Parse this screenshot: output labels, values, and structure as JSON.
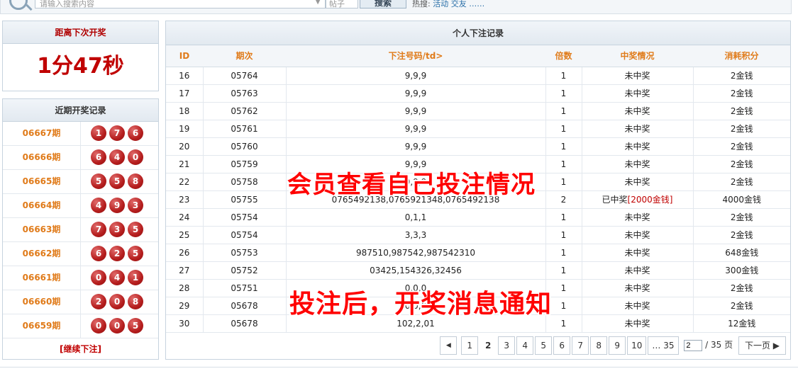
{
  "topbar": {
    "search_placeholder": "请输入搜索内容",
    "select_value": "帖子",
    "search_button": "搜索",
    "hot_label": "热搜:",
    "hot_links": "活动 交友 ……"
  },
  "countdown": {
    "title": "距离下次开奖",
    "time": "1分47秒"
  },
  "recent": {
    "title": "近期开奖记录",
    "rows": [
      {
        "period": "06667期",
        "balls": [
          "1",
          "7",
          "6"
        ]
      },
      {
        "period": "06666期",
        "balls": [
          "6",
          "4",
          "0"
        ]
      },
      {
        "period": "06665期",
        "balls": [
          "5",
          "5",
          "8"
        ]
      },
      {
        "period": "06664期",
        "balls": [
          "4",
          "9",
          "3"
        ]
      },
      {
        "period": "06663期",
        "balls": [
          "7",
          "3",
          "5"
        ]
      },
      {
        "period": "06662期",
        "balls": [
          "6",
          "2",
          "5"
        ]
      },
      {
        "period": "06661期",
        "balls": [
          "0",
          "4",
          "1"
        ]
      },
      {
        "period": "06660期",
        "balls": [
          "2",
          "0",
          "8"
        ]
      },
      {
        "period": "06659期",
        "balls": [
          "0",
          "0",
          "5"
        ]
      }
    ],
    "continue_label": "[继续下注]"
  },
  "records": {
    "title": "个人下注记录",
    "columns": [
      "ID",
      "期次",
      "下注号码/td>",
      "倍数",
      "中奖情况",
      "消耗积分"
    ],
    "rows": [
      {
        "id": "16",
        "period": "05764",
        "numbers": "9,9,9",
        "multiple": "1",
        "result": "未中奖",
        "prize": "",
        "cost": "2金钱"
      },
      {
        "id": "17",
        "period": "05763",
        "numbers": "9,9,9",
        "multiple": "1",
        "result": "未中奖",
        "prize": "",
        "cost": "2金钱"
      },
      {
        "id": "18",
        "period": "05762",
        "numbers": "9,9,9",
        "multiple": "1",
        "result": "未中奖",
        "prize": "",
        "cost": "2金钱"
      },
      {
        "id": "19",
        "period": "05761",
        "numbers": "9,9,9",
        "multiple": "1",
        "result": "未中奖",
        "prize": "",
        "cost": "2金钱"
      },
      {
        "id": "20",
        "period": "05760",
        "numbers": "9,9,9",
        "multiple": "1",
        "result": "未中奖",
        "prize": "",
        "cost": "2金钱"
      },
      {
        "id": "21",
        "period": "05759",
        "numbers": "9,9,9",
        "multiple": "1",
        "result": "未中奖",
        "prize": "",
        "cost": "2金钱"
      },
      {
        "id": "22",
        "period": "05758",
        "numbers": "9,9,9",
        "multiple": "1",
        "result": "未中奖",
        "prize": "",
        "cost": "2金钱"
      },
      {
        "id": "23",
        "period": "05755",
        "numbers": "0765492138,0765921348,0765492138",
        "multiple": "2",
        "result": "已中奖",
        "prize": "[2000金钱]",
        "cost": "4000金钱"
      },
      {
        "id": "24",
        "period": "05754",
        "numbers": "0,1,1",
        "multiple": "1",
        "result": "未中奖",
        "prize": "",
        "cost": "2金钱"
      },
      {
        "id": "25",
        "period": "05754",
        "numbers": "3,3,3",
        "multiple": "1",
        "result": "未中奖",
        "prize": "",
        "cost": "2金钱"
      },
      {
        "id": "26",
        "period": "05753",
        "numbers": "987510,987542,987542310",
        "multiple": "1",
        "result": "未中奖",
        "prize": "",
        "cost": "648金钱"
      },
      {
        "id": "27",
        "period": "05752",
        "numbers": "03425,154326,32456",
        "multiple": "1",
        "result": "未中奖",
        "prize": "",
        "cost": "300金钱"
      },
      {
        "id": "28",
        "period": "05751",
        "numbers": "0,0,0",
        "multiple": "1",
        "result": "未中奖",
        "prize": "",
        "cost": "2金钱"
      },
      {
        "id": "29",
        "period": "05678",
        "numbers": "0,0,0",
        "multiple": "1",
        "result": "未中奖",
        "prize": "",
        "cost": "2金钱"
      },
      {
        "id": "30",
        "period": "05678",
        "numbers": "102,2,01",
        "multiple": "1",
        "result": "未中奖",
        "prize": "",
        "cost": "12金钱"
      }
    ]
  },
  "pager": {
    "prev": "◀",
    "pages": [
      "1",
      "2",
      "3",
      "4",
      "5",
      "6",
      "7",
      "8",
      "9",
      "10",
      "… 35"
    ],
    "current": "2",
    "jump_value": "2",
    "total": "/ 35 页",
    "next": "下一页 ▶"
  },
  "overlay": {
    "caption1": "会员查看自己投注情况",
    "caption2": "投注后，开奖消息通知"
  },
  "colors": {
    "accent": "#e07b1a",
    "red": "#c00000",
    "ball": "#b51d1d",
    "header_bg": "#f3f6f9"
  }
}
